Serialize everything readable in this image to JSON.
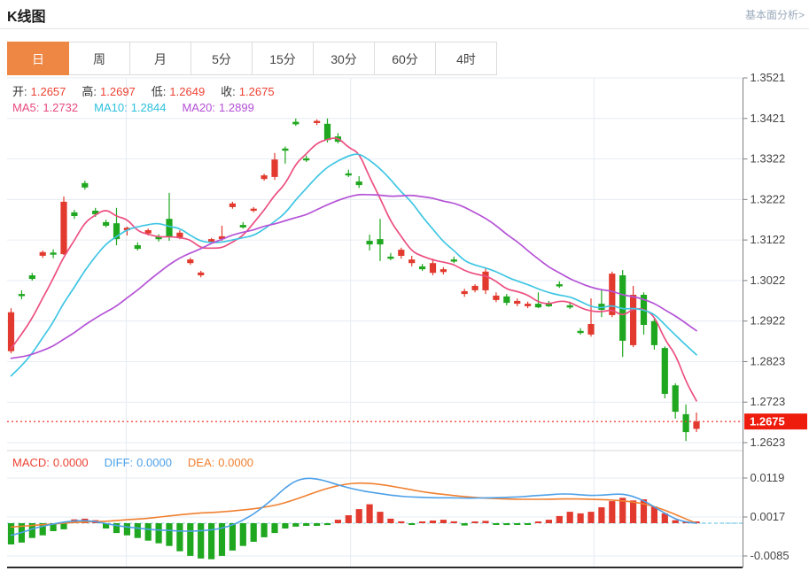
{
  "page": {
    "title": "K线图",
    "link": "基本面分析>"
  },
  "tabs": {
    "items": [
      {
        "key": "day",
        "label": "日",
        "active": true
      },
      {
        "key": "week",
        "label": "周",
        "active": false
      },
      {
        "key": "month",
        "label": "月",
        "active": false
      },
      {
        "key": "m5",
        "label": "5分",
        "active": false
      },
      {
        "key": "m15",
        "label": "15分",
        "active": false
      },
      {
        "key": "m30",
        "label": "30分",
        "active": false
      },
      {
        "key": "m60",
        "label": "60分",
        "active": false
      },
      {
        "key": "h4",
        "label": "4时",
        "active": false
      }
    ]
  },
  "legend": {
    "open_label": "开:",
    "open": "1.2657",
    "high_label": "高:",
    "high": "1.2697",
    "low_label": "低:",
    "low": "1.2649",
    "close_label": "收:",
    "close": "1.2675",
    "ma5_label": "MA5:",
    "ma5": "1.2732",
    "ma10_label": "MA10:",
    "ma10": "1.2844",
    "ma20_label": "MA20:",
    "ma20": "1.2899"
  },
  "macd_legend": {
    "macd_label": "MACD:",
    "macd": "0.0000",
    "diff_label": "DIFF:",
    "diff": "0.0000",
    "dea_label": "DEA:",
    "dea": "0.0000"
  },
  "colors": {
    "up": "#e23a2e",
    "down": "#1fa71f",
    "ma5": "#ec4f80",
    "ma10": "#3fc6e3",
    "ma20": "#b553d6",
    "dif": "#4da0e8",
    "dea": "#f08030",
    "grid": "#e6ecf3",
    "axis": "#7f7f7f",
    "axis_text": "#444444",
    "marker_bg": "#ee1c0c",
    "marker_text": "#ffffff",
    "price_line": "#f3473b",
    "zero_dash": "#8fd4e8",
    "panel_divider": "#d7d7d7",
    "bottom_axis": "#2b2b2b",
    "tab_active": "#ee8644"
  },
  "chart_data": [
    {
      "type": "candlestick",
      "title": "K线图",
      "xlabel": "",
      "ylabel": "",
      "grid": true,
      "legend_position": "top-left",
      "y_axis_labels": [
        "1.3521",
        "1.3421",
        "1.3322",
        "1.3222",
        "1.3122",
        "1.3022",
        "1.2922",
        "1.2823",
        "1.2723",
        "1.2623"
      ],
      "ylim": [
        1.2623,
        1.3521
      ],
      "x_gridline_fractions": [
        0.162,
        0.467,
        0.798
      ],
      "current_price": 1.2675,
      "current_price_label": "1.2675",
      "ma_periods": [
        5,
        10,
        20
      ],
      "prehistory_closes": [
        1.292,
        1.2905,
        1.289,
        1.288,
        1.287,
        1.2865,
        1.286,
        1.2855,
        1.285,
        1.2845,
        1.274,
        1.272,
        1.27,
        1.271,
        1.273,
        1.281,
        1.283,
        1.284,
        1.285
      ],
      "candles": [
        [
          1.2848,
          1.2954,
          1.2843,
          1.2944
        ],
        [
          1.2989,
          1.2998,
          1.2976,
          1.2985
        ],
        [
          1.3035,
          1.3041,
          1.3022,
          1.3026
        ],
        [
          1.3083,
          1.3096,
          1.3078,
          1.3092
        ],
        [
          1.3091,
          1.3099,
          1.3077,
          1.3087
        ],
        [
          1.3087,
          1.3229,
          1.3085,
          1.3216
        ],
        [
          1.319,
          1.3196,
          1.3174,
          1.3181
        ],
        [
          1.3262,
          1.3268,
          1.3246,
          1.3251
        ],
        [
          1.3194,
          1.3201,
          1.3179,
          1.3185
        ],
        [
          1.3166,
          1.3172,
          1.3153,
          1.3157
        ],
        [
          1.3163,
          1.3201,
          1.3109,
          1.3124
        ],
        [
          1.3146,
          1.3155,
          1.3133,
          1.3152
        ],
        [
          1.3109,
          1.3116,
          1.3096,
          1.31
        ],
        [
          1.3138,
          1.315,
          1.3133,
          1.3146
        ],
        [
          1.313,
          1.3136,
          1.3118,
          1.3124
        ],
        [
          1.3174,
          1.3238,
          1.312,
          1.3129
        ],
        [
          1.3128,
          1.3146,
          1.3124,
          1.314
        ],
        [
          1.3065,
          1.3078,
          1.3061,
          1.3074
        ],
        [
          1.3035,
          1.3046,
          1.303,
          1.3042
        ],
        [
          1.3118,
          1.3127,
          1.3113,
          1.3124
        ],
        [
          1.3124,
          1.3157,
          1.312,
          1.3131
        ],
        [
          1.3203,
          1.3216,
          1.3199,
          1.3212
        ],
        [
          1.3159,
          1.3166,
          1.315,
          1.3153
        ],
        [
          1.3194,
          1.3203,
          1.319,
          1.3199
        ],
        [
          1.3272,
          1.3285,
          1.3268,
          1.3281
        ],
        [
          1.3277,
          1.3336,
          1.327,
          1.332
        ],
        [
          1.3347,
          1.3352,
          1.331,
          1.3343
        ],
        [
          1.3413,
          1.3421,
          1.3403,
          1.3407
        ],
        [
          1.3323,
          1.333,
          1.3314,
          1.3318
        ],
        [
          1.3411,
          1.3419,
          1.3405,
          1.3415
        ],
        [
          1.3408,
          1.3421,
          1.3362,
          1.3368
        ],
        [
          1.3377,
          1.3385,
          1.336,
          1.3364
        ],
        [
          1.3286,
          1.3295,
          1.3277,
          1.3281
        ],
        [
          1.3266,
          1.3279,
          1.325,
          1.3257
        ],
        [
          1.312,
          1.3135,
          1.3096,
          1.3111
        ],
        [
          1.3124,
          1.3174,
          1.307,
          1.3111
        ],
        [
          1.3081,
          1.309,
          1.3072,
          1.3076
        ],
        [
          1.3083,
          1.3103,
          1.3076,
          1.3098
        ],
        [
          1.3065,
          1.3083,
          1.3057,
          1.3074
        ],
        [
          1.3057,
          1.3063,
          1.3046,
          1.305
        ],
        [
          1.3041,
          1.3076,
          1.3035,
          1.3065
        ],
        [
          1.3043,
          1.3055,
          1.3037,
          1.305
        ],
        [
          1.3074,
          1.3081,
          1.3065,
          1.307
        ],
        [
          1.2989,
          1.3002,
          1.2982,
          1.2996
        ],
        [
          1.2998,
          1.3013,
          1.2993,
          1.3009
        ],
        [
          1.2998,
          1.3054,
          1.2989,
          1.3044
        ],
        [
          1.2974,
          1.2993,
          1.2969,
          1.2985
        ],
        [
          1.2983,
          1.2989,
          1.2961,
          1.2967
        ],
        [
          1.2965,
          1.2978,
          1.2959,
          1.2972
        ],
        [
          1.2959,
          1.297,
          1.2954,
          1.2965
        ],
        [
          1.2965,
          1.2993,
          1.2954,
          1.2956
        ],
        [
          1.2965,
          1.2972,
          1.2957,
          1.2959
        ],
        [
          1.3013,
          1.302,
          1.3004,
          1.3009
        ],
        [
          1.2961,
          1.297,
          1.2952,
          1.2956
        ],
        [
          1.2898,
          1.2905,
          1.2889,
          1.2894
        ],
        [
          1.2889,
          1.2978,
          1.2884,
          1.2915
        ],
        [
          1.2965,
          1.2998,
          1.2932,
          1.295
        ],
        [
          1.2937,
          1.3044,
          1.2932,
          1.3039
        ],
        [
          1.3035,
          1.3048,
          1.2834,
          1.2874
        ],
        [
          1.2863,
          1.3009,
          1.2858,
          1.2987
        ],
        [
          1.2987,
          1.2993,
          1.2889,
          1.2913
        ],
        [
          1.2922,
          1.2928,
          1.2852,
          1.2863
        ],
        [
          1.2856,
          1.286,
          1.2732,
          1.2743
        ],
        [
          1.2764,
          1.2769,
          1.2682,
          1.2699
        ],
        [
          1.2693,
          1.2717,
          1.2627,
          1.2649
        ],
        [
          1.2657,
          1.2697,
          1.2649,
          1.2675
        ]
      ]
    },
    {
      "type": "bar",
      "subtype": "macd",
      "y_axis_labels": [
        "0.0119",
        "0.0017",
        "-0.0085"
      ],
      "ylim": [
        -0.0085,
        0.0119
      ],
      "hist": [
        -0.0056,
        -0.0051,
        -0.0039,
        -0.0032,
        -0.0021,
        -0.0016,
        0.001,
        0.0012,
        0.0008,
        -0.0014,
        -0.0026,
        -0.0032,
        -0.0039,
        -0.0046,
        -0.0053,
        -0.006,
        -0.0074,
        -0.0086,
        -0.0093,
        -0.0095,
        -0.0086,
        -0.0072,
        -0.006,
        -0.0049,
        -0.0037,
        -0.0026,
        -0.0014,
        -0.0009,
        -0.0007,
        -0.0007,
        -0.0005,
        0.0009,
        0.0021,
        0.0037,
        0.005,
        0.003,
        0.0012,
        0.0005,
        -0.0004,
        0.0004,
        0.0007,
        0.0009,
        0.0005,
        -0.0006,
        0.0004,
        0.0006,
        -0.0004,
        -0.0005,
        -0.0004,
        -0.0003,
        0.0002,
        0.0009,
        0.0019,
        0.003,
        0.0026,
        0.003,
        0.0042,
        0.0058,
        0.0067,
        0.006,
        0.0063,
        0.0044,
        0.0026,
        0.0008,
        0.0002,
        0.0
      ],
      "dif": [
        -0.0032,
        -0.0025,
        -0.0015,
        -0.0008,
        -0.0002,
        0.0003,
        0.0006,
        0.0007,
        0.0004,
        -0.0001,
        -0.0006,
        -0.001,
        -0.0013,
        -0.0016,
        -0.0018,
        -0.0019,
        -0.0021,
        -0.0021,
        -0.002,
        -0.0018,
        -0.0013,
        -0.0005,
        0.0008,
        0.0024,
        0.0045,
        0.0068,
        0.0094,
        0.0112,
        0.0119,
        0.0117,
        0.011,
        0.0101,
        0.0093,
        0.0087,
        0.0082,
        0.0078,
        0.0074,
        0.0071,
        0.0069,
        0.0068,
        0.0067,
        0.0067,
        0.0067,
        0.0066,
        0.0066,
        0.0067,
        0.0067,
        0.0068,
        0.0069,
        0.0071,
        0.0073,
        0.0075,
        0.0077,
        0.0077,
        0.0075,
        0.0073,
        0.0074,
        0.0076,
        0.0077,
        0.0071,
        0.0059,
        0.0043,
        0.0026,
        0.0011,
        0.0003,
        0.0
      ],
      "dea": [
        -0.001,
        -0.0008,
        -0.0006,
        -0.0004,
        -0.0002,
        0.0,
        0.0002,
        0.0003,
        0.0004,
        0.0005,
        0.0007,
        0.0009,
        0.0011,
        0.0013,
        0.0016,
        0.0019,
        0.0022,
        0.0025,
        0.0027,
        0.0028,
        0.003,
        0.0032,
        0.0035,
        0.0038,
        0.0042,
        0.0047,
        0.0054,
        0.0063,
        0.0073,
        0.0083,
        0.0092,
        0.0099,
        0.0104,
        0.0106,
        0.0105,
        0.0102,
        0.0098,
        0.0093,
        0.0088,
        0.0083,
        0.0079,
        0.0076,
        0.0073,
        0.007,
        0.0068,
        0.0066,
        0.0065,
        0.0064,
        0.0063,
        0.0063,
        0.0063,
        0.0063,
        0.0064,
        0.0064,
        0.0064,
        0.0063,
        0.0062,
        0.0061,
        0.0059,
        0.0056,
        0.0051,
        0.0044,
        0.0034,
        0.0023,
        0.0011,
        0.0
      ]
    }
  ]
}
